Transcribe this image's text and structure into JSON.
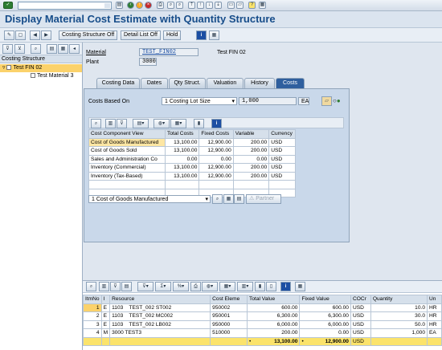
{
  "window": {
    "title": "Display Material Cost Estimate with Quantity Structure"
  },
  "toolbar": {
    "btn_structure_off": "Costing Structure Off",
    "btn_detail_off": "Detail List Off",
    "btn_hold": "Hold"
  },
  "left": {
    "header": "Costing Structure",
    "root": "Test FIN 02",
    "child": "Test Material 3"
  },
  "header": {
    "material_label": "Material",
    "material_value": "TEST_FIN02",
    "material_desc": "Test FIN 02",
    "plant_label": "Plant",
    "plant_value": "3000"
  },
  "tabs": [
    {
      "label": "Costing Data"
    },
    {
      "label": "Dates"
    },
    {
      "label": "Qty Struct."
    },
    {
      "label": "Valuation"
    },
    {
      "label": "History"
    },
    {
      "label": "Costs"
    }
  ],
  "costs": {
    "based_on_label": "Costs Based On",
    "based_on_value": "1 Costing Lot Size",
    "qty_value": "1,000",
    "unit": "EA",
    "columns": [
      "Cost Component View",
      "Total Costs",
      "Fixed Costs",
      "Variable",
      "Currency"
    ],
    "rows": [
      [
        "Cost of Goods Manufactured",
        "13,100.00",
        "12,900.00",
        "200.00",
        "USD"
      ],
      [
        "Cost of Goods Sold",
        "13,100.00",
        "12,900.00",
        "200.00",
        "USD"
      ],
      [
        "Sales and Administration Co",
        "0.00",
        "0.00",
        "0.00",
        "USD"
      ],
      [
        "Inventory (Commercial)",
        "13,100.00",
        "12,900.00",
        "200.00",
        "USD"
      ],
      [
        "Inventory (Tax-Based)",
        "13,100.00",
        "12,900.00",
        "200.00",
        "USD"
      ]
    ],
    "view_select": "1 Cost of Goods Manufactured",
    "partner_label": "Partner"
  },
  "itemization": {
    "columns": [
      "ItmNo",
      "I",
      "Resource",
      "Cost Eleme",
      "Total Value",
      "Fixed Value",
      "COCr",
      "Quantity",
      "Un"
    ],
    "rows": [
      [
        "1",
        "E",
        "1103    TEST_002 ST002",
        "950002",
        "600.00",
        "600.00",
        "USD",
        "10.0",
        "HR"
      ],
      [
        "2",
        "E",
        "1103    TEST_002 MC002",
        "950001",
        "6,300.00",
        "6,300.00",
        "USD",
        "30.0",
        "HR"
      ],
      [
        "3",
        "E",
        "1103    TEST_002 LB002",
        "950000",
        "6,000.00",
        "6,000.00",
        "USD",
        "50.0",
        "HR"
      ],
      [
        "4",
        "M",
        "3000 TEST3",
        "510000",
        "200.00",
        "0.00",
        "USD",
        "1,000",
        "EA"
      ]
    ],
    "sum": {
      "mark": "•",
      "total": "13,100.00",
      "fixed": "12,900.00",
      "currency": "USD"
    }
  }
}
